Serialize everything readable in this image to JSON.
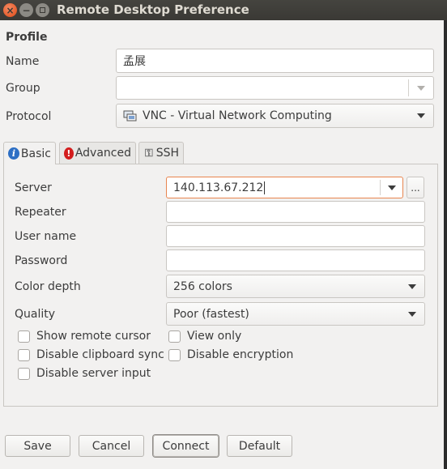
{
  "window": {
    "title": "Remote Desktop Preference"
  },
  "profile": {
    "heading": "Profile",
    "name_label": "Name",
    "name_value": "孟展",
    "group_label": "Group",
    "group_value": "",
    "protocol_label": "Protocol",
    "protocol_value": "VNC - Virtual Network Computing"
  },
  "tabs": [
    {
      "label": "Basic",
      "icon": "info-icon"
    },
    {
      "label": "Advanced",
      "icon": "warning-icon"
    },
    {
      "label": "SSH",
      "icon": "ssh-key-icon"
    }
  ],
  "basic": {
    "server_label": "Server",
    "server_value": "140.113.67.212",
    "browse_label": "...",
    "repeater_label": "Repeater",
    "repeater_value": "",
    "username_label": "User name",
    "username_value": "",
    "password_label": "Password",
    "password_value": "",
    "color_depth_label": "Color depth",
    "color_depth_value": "256 colors",
    "quality_label": "Quality",
    "quality_value": "Poor (fastest)",
    "checkboxes": [
      {
        "label": "Show remote cursor",
        "checked": false
      },
      {
        "label": "View only",
        "checked": false
      },
      {
        "label": "Disable clipboard sync",
        "checked": false
      },
      {
        "label": "Disable encryption",
        "checked": false
      },
      {
        "label": "Disable server input",
        "checked": false
      }
    ]
  },
  "buttons": {
    "save": "Save",
    "cancel": "Cancel",
    "connect": "Connect",
    "default": "Default"
  },
  "colors": {
    "focus_accent": "#e8854f",
    "close_button": "#df4a16",
    "titlebar": "#3c3b37"
  }
}
